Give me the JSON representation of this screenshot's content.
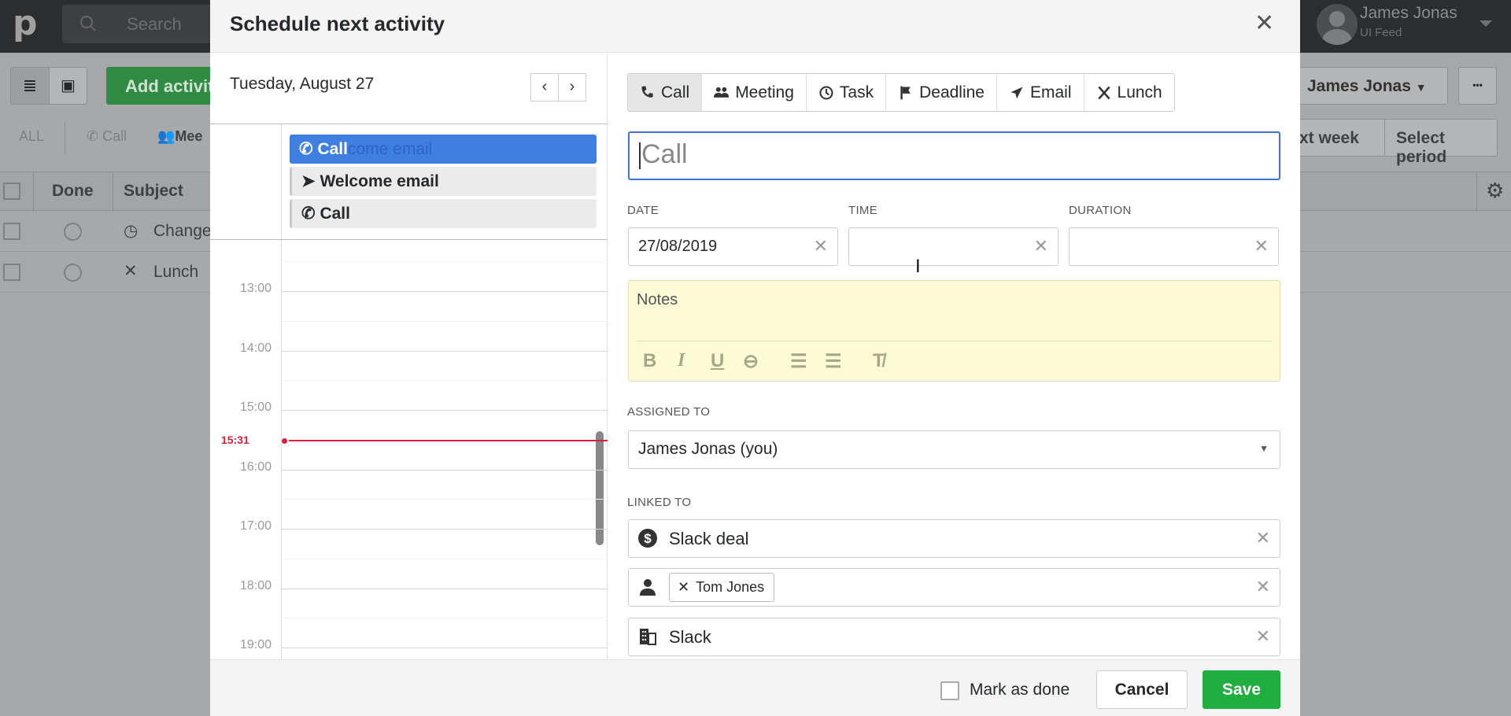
{
  "background": {
    "search_placeholder": "Search",
    "add_activity_label": "Add activit",
    "filters": [
      "ALL",
      "Call",
      "Mee"
    ],
    "table": {
      "headers": [
        "Done",
        "Subject"
      ],
      "rows": [
        {
          "subject": "Change"
        },
        {
          "subject": "Lunch"
        }
      ]
    },
    "user": {
      "name": "James Jonas",
      "company": "UI Feed"
    },
    "owner_filter_label": "James Jonas",
    "more_label": "•••",
    "period_buttons": [
      "xt week",
      "Select period"
    ]
  },
  "modal": {
    "title": "Schedule next activity",
    "calendar": {
      "date_label": "Tuesday, August 27",
      "all_day_events": [
        {
          "label": "Call",
          "ghost": "come email",
          "icon": "phone-icon",
          "active": true
        },
        {
          "label": "Welcome email",
          "icon": "send-icon",
          "active": false
        },
        {
          "label": "Call",
          "icon": "phone-icon",
          "active": false
        }
      ],
      "hours": [
        "13:00",
        "14:00",
        "15:00",
        "16:00",
        "17:00",
        "18:00",
        "19:00"
      ],
      "now_label": "15:31",
      "now_color": "#d81f3a"
    },
    "types": [
      {
        "label": "Call",
        "icon": "phone-icon",
        "selected": true
      },
      {
        "label": "Meeting",
        "icon": "people-icon",
        "selected": false
      },
      {
        "label": "Task",
        "icon": "clock-icon",
        "selected": false
      },
      {
        "label": "Deadline",
        "icon": "flag-icon",
        "selected": false
      },
      {
        "label": "Email",
        "icon": "send-icon",
        "selected": false
      },
      {
        "label": "Lunch",
        "icon": "utensils-icon",
        "selected": false
      }
    ],
    "subject_placeholder": "Call",
    "date": {
      "label": "DATE",
      "value": "27/08/2019"
    },
    "time": {
      "label": "TIME",
      "value": ""
    },
    "duration": {
      "label": "DURATION",
      "value": ""
    },
    "notes_placeholder": "Notes",
    "assigned": {
      "label": "ASSIGNED TO",
      "value": "James Jonas (you)"
    },
    "linked": {
      "label": "LINKED TO",
      "deal": "Slack deal",
      "person": "Tom Jones",
      "organization": "Slack"
    },
    "footer": {
      "mark_done": "Mark as done",
      "cancel": "Cancel",
      "save": "Save"
    },
    "accent": "#3c74d8",
    "save_color": "#1fae3f"
  }
}
